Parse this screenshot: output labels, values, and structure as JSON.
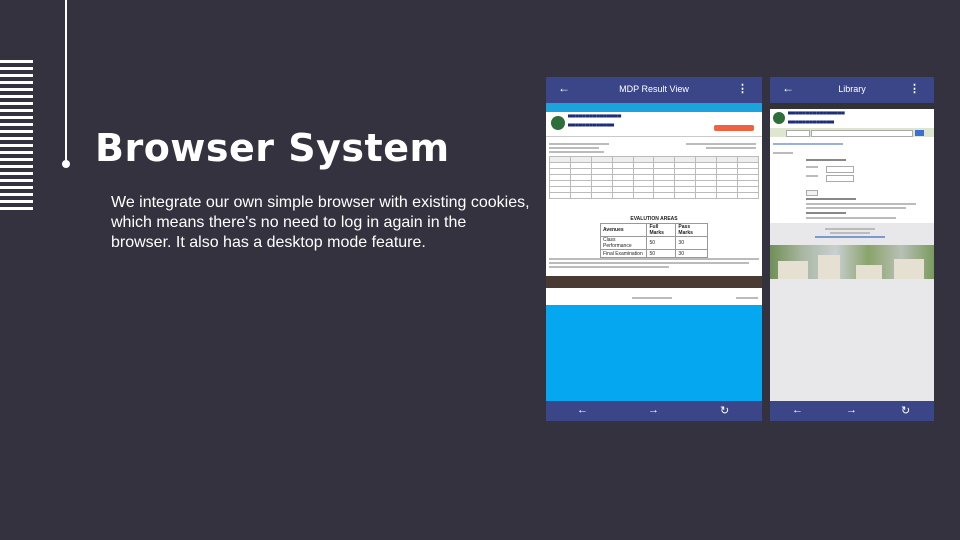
{
  "slide": {
    "title": "Browser System",
    "description": "We integrate our own simple browser with existing cookies, which means there's no need to log in again in the browser. It also has a desktop mode feature."
  },
  "phone_result": {
    "app_title": "MDP Result View",
    "back_icon": "arrow-left-icon",
    "more_icon": "more-vertical-icon",
    "eval_title": "EVALUTION AREAS",
    "eval_headers": [
      "Avenues",
      "Full Marks",
      "Pass Marks"
    ],
    "eval_rows": [
      [
        "Class Performance",
        "50",
        "30"
      ],
      [
        "Final Examination",
        "50",
        "30"
      ]
    ],
    "nav_icons": [
      "arrow-left-icon",
      "arrow-right-icon",
      "refresh-icon"
    ],
    "colors": {
      "appbar": "#3a4687",
      "nav_strip": "#1aa3dd",
      "blue_area": "#04a7f0"
    }
  },
  "phone_library": {
    "app_title": "Library",
    "back_icon": "arrow-left-icon",
    "more_icon": "more-vertical-icon",
    "nav_icons": [
      "arrow-left-icon",
      "arrow-right-icon",
      "refresh-icon"
    ]
  }
}
